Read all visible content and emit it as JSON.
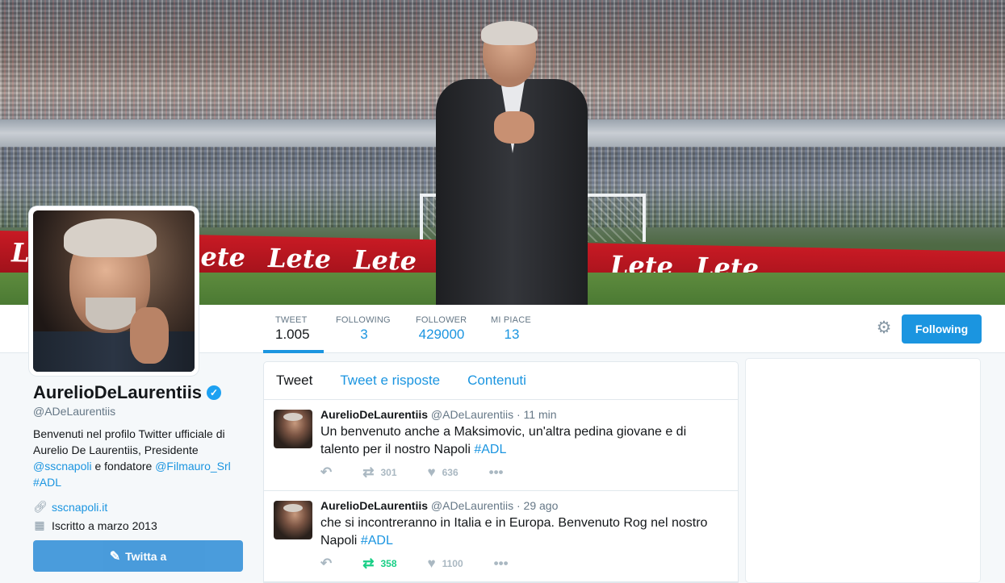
{
  "stats": [
    {
      "label": "TWEET",
      "value": "1.005"
    },
    {
      "label": "FOLLOWING",
      "value": "3"
    },
    {
      "label": "FOLLOWER",
      "value": "429000"
    },
    {
      "label": "MI PIACE",
      "value": "13"
    }
  ],
  "banner": {
    "board_text": "Lete"
  },
  "follow_button": "Following",
  "profile": {
    "name": "AurelioDeLaurentiis",
    "handle": "@ADeLaurentiis",
    "bio_part1": "Benvenuti nel profilo Twitter ufficiale di Aurelio De Laurentiis, Presidente ",
    "bio_link1": "@sscnapoli",
    "bio_part2": " e fondatore ",
    "bio_link2": "@Filmauro_Srl",
    "bio_tag": "#ADL",
    "website": "sscnapoli.it",
    "joined": "Iscritto a marzo 2013",
    "tweet_to": "Twitta a"
  },
  "tabs": [
    "Tweet",
    "Tweet e risposte",
    "Contenuti"
  ],
  "tweets": [
    {
      "name": "AurelioDeLaurentiis",
      "handle": "@ADeLaurentiis",
      "time": "11 min",
      "text": "Un benvenuto anche a Maksimovic, un'altra pedina giovane e di talento per il nostro Napoli ",
      "hashtag": "#ADL",
      "retweets": "301",
      "likes": "636"
    },
    {
      "name": "AurelioDeLaurentiis",
      "handle": "@ADeLaurentiis",
      "time": "29 ago",
      "text": "che si incontreranno in Italia e in Europa. Benvenuto Rog nel nostro Napoli ",
      "hashtag": "#ADL",
      "retweets": "358",
      "likes": "1100"
    }
  ],
  "colors": {
    "accent": "#1b95e0",
    "retweet_active": "#19cf86",
    "ad_red": "#c81a24"
  },
  "icons": [
    "gear-icon",
    "verified-icon",
    "link-icon",
    "calendar-icon",
    "quill-icon",
    "reply-icon",
    "retweet-icon",
    "heart-icon",
    "more-icon"
  ]
}
